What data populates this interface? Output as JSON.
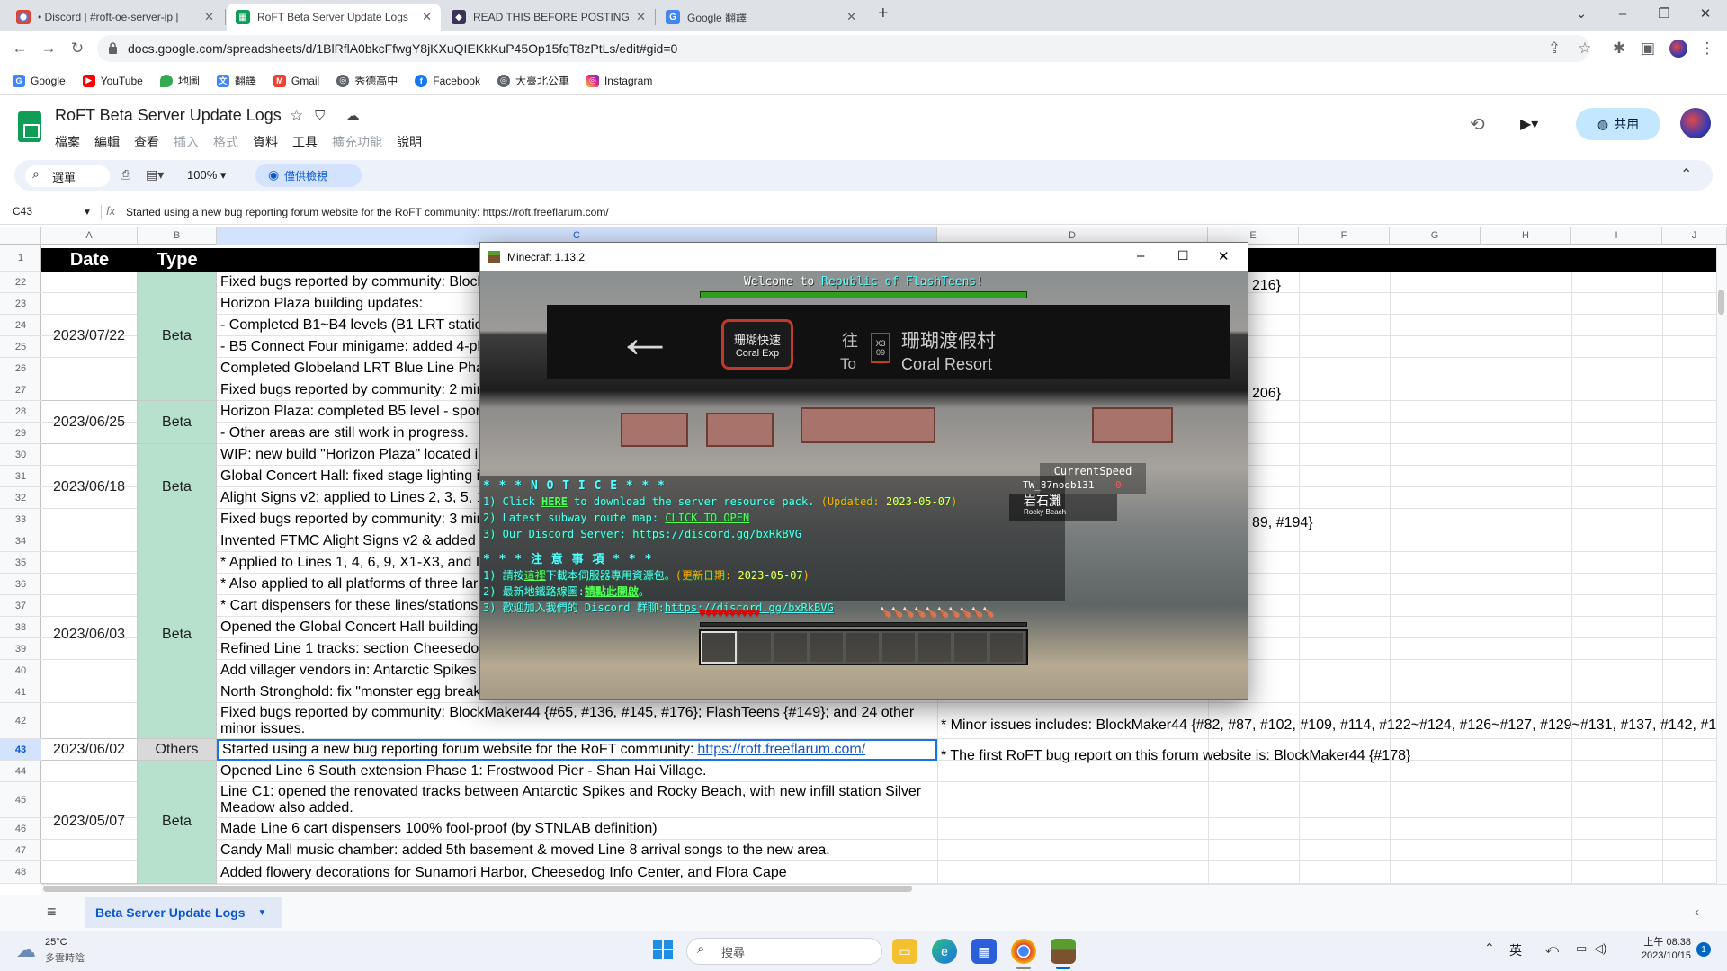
{
  "browser": {
    "tabs": [
      {
        "title": "• Discord | #roft-oe-server-ip |",
        "active": false
      },
      {
        "title": "RoFT Beta Server Update Logs",
        "active": true
      },
      {
        "title": "READ THIS BEFORE POSTING",
        "active": false
      },
      {
        "title": "Google 翻譯",
        "active": false
      }
    ],
    "url": "docs.google.com/spreadsheets/d/1BlRflA0bkcFfwgY8jKXuQIEKkKuP45Op15fqT8zPtLs/edit#gid=0",
    "bookmarks": [
      "Google",
      "YouTube",
      "地圖",
      "翻譯",
      "Gmail",
      "秀德高中",
      "Facebook",
      "大臺北公車",
      "Instagram"
    ]
  },
  "sheets": {
    "doc_title": "RoFT Beta Server Update Logs",
    "menu": [
      "檔案",
      "編輯",
      "查看",
      "插入",
      "格式",
      "資料",
      "工具",
      "擴充功能",
      "說明"
    ],
    "menu_disabled": [
      "插入",
      "格式",
      "擴充功能"
    ],
    "share_label": "共用",
    "search_label": "選單",
    "zoom": "100%",
    "view_only_label": "僅供檢視",
    "name_box": "C43",
    "formula": "Started using a new bug reporting forum website for the RoFT community: https://roft.freeflarum.com/",
    "columns": [
      "A",
      "B",
      "C",
      "D",
      "E",
      "F",
      "G",
      "H",
      "I",
      "J"
    ],
    "header": {
      "date": "Date",
      "type": "Type"
    },
    "rows": [
      "1",
      "22",
      "23",
      "24",
      "25",
      "26",
      "27",
      "28",
      "29",
      "30",
      "31",
      "32",
      "33",
      "34",
      "35",
      "36",
      "37",
      "38",
      "39",
      "40",
      "41",
      "42",
      "43",
      "44",
      "45",
      "46",
      "47",
      "48"
    ],
    "selected_row": "43",
    "groups": [
      {
        "date": "2023/07/22",
        "type": "Beta"
      },
      {
        "date": "2023/06/25",
        "type": "Beta"
      },
      {
        "date": "2023/06/18",
        "type": "Beta"
      },
      {
        "date": "2023/06/03",
        "type": "Beta"
      },
      {
        "date": "2023/06/02",
        "type": "Others"
      },
      {
        "date": "2023/05/07",
        "type": "Beta"
      }
    ],
    "c_cells": [
      "Fixed bugs reported by community: Block",
      "Horizon Plaza building updates:",
      "- Completed B1~B4 levels (B1 LRT statio",
      "- B5 Connect Four minigame: added 4-pl",
      "Completed Globeland LRT Blue Line Pha",
      "Fixed bugs reported by community: 2 mir",
      "Horizon Plaza: completed B5 level - spor",
      "- Other areas are still work in progress.",
      "WIP: new build \"Horizon Plaza\" located i",
      "Global Concert Hall: fixed stage lighting i",
      "Alight Signs v2: applied to Lines 2, 3, 5, 1",
      "Fixed bugs reported by community: 3 mir",
      "Invented FTMC Alight Signs v2 & added",
      "* Applied to Lines 1, 4, 6, 9, X1-X3, and I",
      "* Also applied to all platforms of three lar",
      "* Cart dispensers for these lines/stations",
      "Opened the Global Concert Hall building",
      "Refined Line 1 tracks: section Cheesedo",
      "Add villager vendors in: Antarctic Spikes",
      "North Stronghold: fix \"monster egg break",
      "Fixed bugs reported by community: BlockMaker44 {#65, #136, #145, #176}; FlashTeens {#149}; and 24 other minor issues."
    ],
    "row43_text": "Started using a new bug reporting forum website for the RoFT community:",
    "row43_link": "https://roft.freeflarum.com/",
    "c_lower": [
      "Opened Line 6 South extension Phase 1: Frostwood Pier - Shan Hai Village.",
      "Line C1: opened the renovated tracks between Antarctic Spikes and Rocky Beach, with new infill station Silver Meadow also added.",
      "Made Line 6 cart dispensers 100% fool-proof (by STNLAB definition)",
      "Candy Mall music chamber: added 5th basement & moved Line 8 arrival songs to the new area.",
      "Added flowery decorations for Sunamori Harbor, Cheesedog Info Center, and Flora Cape"
    ],
    "d_cells": {
      "r22": "216}",
      "r27": "206}",
      "r33": "89, #194}",
      "r42": "* Minor issues includes: BlockMaker44 {#82, #87, #102, #109, #114, #122~#124, #126~#127, #129~#131, #137, #142, #1",
      "r43": "* The first RoFT bug report on this forum website is: BlockMaker44 {#178}"
    },
    "sheet_tab": "Beta Server Update Logs"
  },
  "minecraft": {
    "window_title": "Minecraft 1.13.2",
    "boss_bar_prefix": "Welcome to",
    "boss_bar_name": "Republic of FlashTeens!",
    "sign_left_zh": "珊瑚快速",
    "sign_left_en": "Coral Exp",
    "sign_to_zh": "往",
    "sign_to_en": "To",
    "sign_badge_top": "X3",
    "sign_badge_num": "09",
    "sign_dest_zh": "珊瑚渡假村",
    "sign_dest_en": "Coral Resort",
    "scoreboard_title": "CurrentSpeed",
    "scoreboard_player": "TW_87noob131",
    "scoreboard_value": "0",
    "station_zh": "岩石灘",
    "station_en": "Rocky Beach",
    "notice_title": "* * * N O T I C E * * *",
    "notice1_prefix": "1) Click",
    "notice1_link": "HERE",
    "notice1_mid": "to download the server resource pack.",
    "notice1_updated": "(Updated:",
    "notice1_date": "2023-05-07",
    "notice1_close": ")",
    "notice2_prefix": "2) Latest subway route map:",
    "notice2_link": "CLICK TO OPEN",
    "notice3_prefix": "3) Our Discord Server:",
    "notice3_link": "https://discord.gg/bxRkBVG",
    "zh_title": "* * * 注 意 事 項 * * *",
    "zh1_prefix": "1) 請按",
    "zh1_link": "這裡",
    "zh1_mid": "下載本伺服器專用資源包。",
    "zh1_updated": "(更新日期:",
    "zh1_date": "2023-05-07",
    "zh1_close": ")",
    "zh2_prefix": "2) 最新地鐵路線圖:",
    "zh2_link": "請點此開啟",
    "zh2_end": "。",
    "zh3_prefix": "3) 歡迎加入我們的 Discord 群聊:",
    "zh3_link": "https://discord.gg/bxRkBVG",
    "hearts": 10,
    "hunger": 10
  },
  "taskbar": {
    "weather_temp": "25°C",
    "weather_desc": "多雲時陰",
    "search_placeholder": "搜尋",
    "ime": "英",
    "time": "上午 08:38",
    "date": "2023/10/15",
    "notif_count": "1"
  },
  "colors": {
    "beta": "#b7e1cd",
    "others": "#d9d9d9",
    "link": "#1155cc",
    "mc_green": "#55ff55",
    "mc_aqua": "#55ffff",
    "mc_gold": "#ffaa00",
    "mc_yellow": "#ffff55"
  }
}
